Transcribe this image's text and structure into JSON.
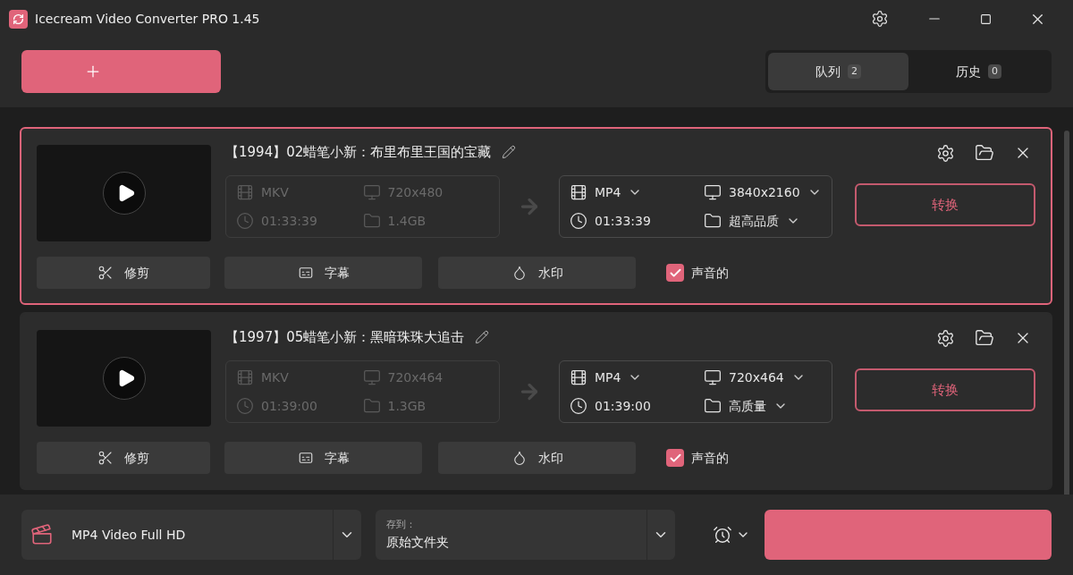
{
  "window": {
    "title": "Icecream Video Converter PRO 1.45"
  },
  "tabs": [
    {
      "label": "队列",
      "count": "2",
      "selected": true
    },
    {
      "label": "历史",
      "count": "0",
      "selected": false
    }
  ],
  "tasks": [
    {
      "title": "【1994】02蜡笔小新：布里布里王国的宝藏",
      "selected": true,
      "source": {
        "format": "MKV",
        "resolution": "720x480",
        "duration": "01:33:39",
        "size": "1.4GB"
      },
      "target": {
        "format": "MP4",
        "resolution": "3840x2160",
        "duration": "01:33:39",
        "quality": "超高品质"
      },
      "convert": "转换",
      "actions": [
        {
          "kind": "trim",
          "label": "修剪"
        },
        {
          "kind": "subtitles",
          "label": "字幕"
        },
        {
          "kind": "watermark",
          "label": "水印"
        }
      ],
      "audio": {
        "label": "声音的",
        "checked": true
      }
    },
    {
      "title": "【1997】05蜡笔小新：黑暗珠珠大追击",
      "selected": false,
      "source": {
        "format": "MKV",
        "resolution": "720x464",
        "duration": "01:39:00",
        "size": "1.3GB"
      },
      "target": {
        "format": "MP4",
        "resolution": "720x464",
        "duration": "01:39:00",
        "quality": "高质量"
      },
      "convert": "转换",
      "actions": [
        {
          "kind": "trim",
          "label": "修剪"
        },
        {
          "kind": "subtitles",
          "label": "字幕"
        },
        {
          "kind": "watermark",
          "label": "水印"
        }
      ],
      "audio": {
        "label": "声音的",
        "checked": true
      }
    }
  ],
  "footer": {
    "preset": "MP4 Video Full HD",
    "save_label": "存到：",
    "save_value": "原始文件夹"
  }
}
